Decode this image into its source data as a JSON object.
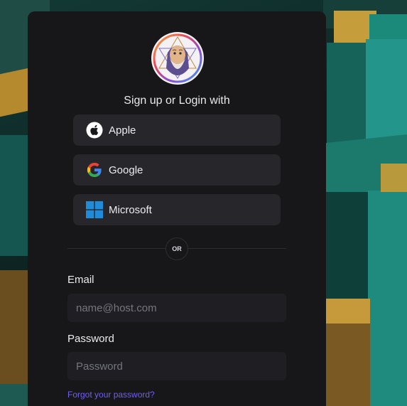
{
  "auth": {
    "heading": "Sign up or Login with",
    "providers": [
      {
        "label": "Apple",
        "icon": "apple-icon"
      },
      {
        "label": "Google",
        "icon": "google-icon"
      },
      {
        "label": "Microsoft",
        "icon": "microsoft-icon"
      }
    ],
    "divider_label": "OR",
    "email": {
      "label": "Email",
      "placeholder": "name@host.com",
      "value": ""
    },
    "password": {
      "label": "Password",
      "placeholder": "Password",
      "value": ""
    },
    "forgot_link": "Forgot your password?"
  },
  "logo": {
    "icon": "bearded-sage-logo-icon"
  },
  "colors": {
    "card_bg": "#17171a",
    "button_bg": "#26262b",
    "input_bg": "#1f1f23",
    "link": "#6f5ff0",
    "microsoft_blue": "#1f8bd9"
  }
}
